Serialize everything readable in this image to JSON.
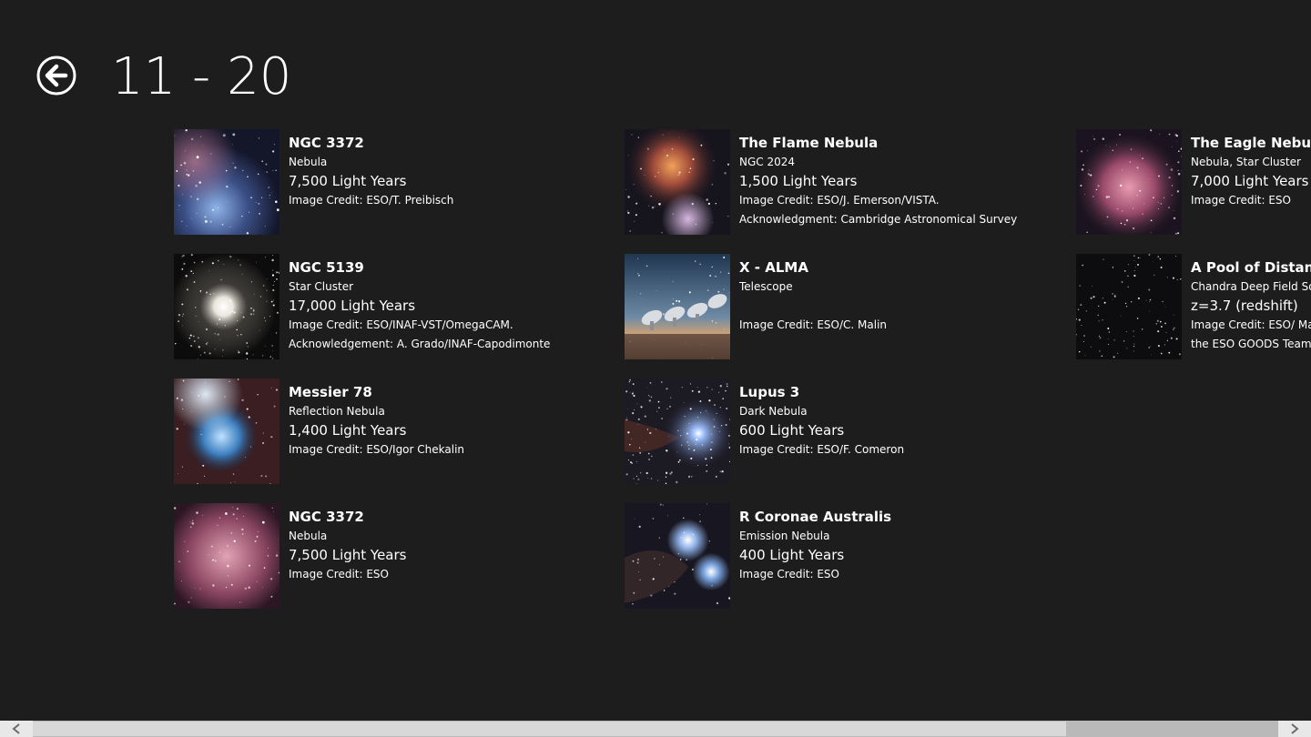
{
  "header": {
    "title": "11 - 20"
  },
  "colors": {
    "background": "#1d1d1d",
    "text": "#ffffff",
    "scrollbar_track": "#b9b9b9",
    "scrollbar_thumb": "#d8d8d8"
  },
  "icons": {
    "back": "back-arrow-icon",
    "scroll_left": "chevron-left-icon",
    "scroll_right": "chevron-right-icon"
  },
  "items": [
    {
      "title": "NGC 3372",
      "category": "Nebula",
      "distance": "7,500 Light Years",
      "credit": [
        "Image Credit: ESO/T. Preibisch"
      ]
    },
    {
      "title": "NGC 5139",
      "category": "Star Cluster",
      "distance": "17,000 Light Years",
      "credit": [
        "Image Credit: ESO/INAF-VST/OmegaCAM.",
        "Acknowledgement: A. Grado/INAF-Capodimonte"
      ]
    },
    {
      "title": "Messier 78",
      "category": "Reflection Nebula",
      "distance": "1,400 Light Years",
      "credit": [
        "Image Credit: ESO/Igor Chekalin"
      ]
    },
    {
      "title": "NGC 3372",
      "category": "Nebula",
      "distance": "7,500 Light Years",
      "credit": [
        "Image Credit: ESO"
      ]
    },
    {
      "title": "The Flame Nebula",
      "category": "NGC 2024",
      "distance": "1,500 Light Years",
      "credit": [
        "Image Credit: ESO/J. Emerson/VISTA.",
        "Acknowledgment: Cambridge Astronomical Survey"
      ]
    },
    {
      "title": "X - ALMA",
      "category": "Telescope",
      "distance": "",
      "credit": [
        "Image Credit: ESO/C. Malin"
      ]
    },
    {
      "title": "Lupus 3",
      "category": "Dark Nebula",
      "distance": "600 Light Years",
      "credit": [
        "Image Credit: ESO/F. Comeron"
      ]
    },
    {
      "title": "R Coronae Australis",
      "category": "Emission Nebula",
      "distance": "400 Light Years",
      "credit": [
        "Image Credit: ESO"
      ]
    },
    {
      "title": "The Eagle Nebula",
      "category": "Nebula, Star Cluster",
      "distance": "7,000 Light Years",
      "credit": [
        "Image Credit: ESO"
      ]
    },
    {
      "title": "A Pool of Distant G",
      "category": "Chandra Deep Field Sou",
      "distance": "z=3.7 (redshift)",
      "credit": [
        "Image Credit: ESO/ Mar",
        "the ESO GOODS Team"
      ]
    }
  ],
  "scrollbar": {
    "position_fraction": 0.0,
    "visible_fraction": 0.83
  }
}
